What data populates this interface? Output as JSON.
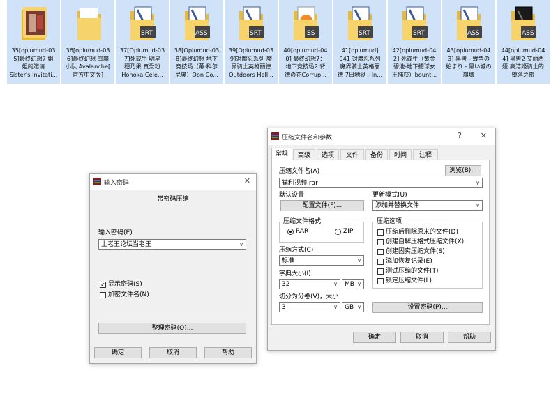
{
  "files": [
    {
      "name": "35[opiumud-03\n5]最终幻想7 姐\n姐的邀请\nSister's invitati...",
      "type": "video"
    },
    {
      "name": "36[opiumud-03\n6]最终幻想 雪崩\n小队 Avalanche[\n官方中文版]",
      "type": "folder"
    },
    {
      "name": "37[Opiumud-03\n7]死或生 明星\n穗乃果 真爱粉\nHonoka Cele...",
      "type": "srt"
    },
    {
      "name": "38[Opiumud-03\n8]最终幻想 地下\n竞技场（蒂·科尔\n尼奥）Don Co...",
      "type": "ass"
    },
    {
      "name": "39[Opiumud-03\n9]对魔忍系列 魔\n界骑士英格丽德\nOutdoors Hell...",
      "type": "srt"
    },
    {
      "name": "40[opiumud-04\n0] 最终幻想7：\n地下竞技场2 背\n德の花Corrup...",
      "type": "ss"
    },
    {
      "name": "41[opiumud]\n041 对魔忍系列\n魔界骑士英格丽\n德 7日地狱 - In...",
      "type": "srt"
    },
    {
      "name": "42[opiumud-04\n2] 死或生（黄金\n碧池-地下擂球女\n王捕获）bount...",
      "type": "srt"
    },
    {
      "name": "43[opiumud-04\n3] 黑兽 - 戦争の\n始まり - 黑い城の\n崩壊",
      "type": "ass"
    },
    {
      "name": "44[opiumud-04\n4] 黑兽2 艾丽西\n娅 高洁姬骑士的\n堕落之旅",
      "type": "dark"
    }
  ],
  "password_dialog": {
    "title": "输入密码",
    "header": "带密码压缩",
    "password_label": "输入密码(E)",
    "password_value": "上老王论坛当老王",
    "show_password": {
      "label": "显示密码(S)",
      "checked": true
    },
    "encrypt_names": {
      "label": "加密文件名(N)",
      "checked": false
    },
    "organize_button": "整理密码(O)...",
    "ok": "确定",
    "cancel": "取消",
    "help": "帮助",
    "close_glyph": "✕"
  },
  "archive_dialog": {
    "title": "压缩文件名和参数",
    "help_glyph": "?",
    "close_glyph": "✕",
    "tabs": [
      "常规",
      "高级",
      "选项",
      "文件",
      "备份",
      "时间",
      "注释"
    ],
    "archive_name_label": "压缩文件名(A)",
    "archive_name_value": "猫利视频.rar",
    "browse_button": "浏览(B)...",
    "default_settings_label": "默认设置",
    "profile_button": "配置文件(F)...",
    "update_mode_label": "更新模式(U)",
    "update_mode_value": "添加并替换文件",
    "format_group_label": "压缩文件格式",
    "format_rar": "RAR",
    "format_zip": "ZIP",
    "method_label": "压缩方式(C)",
    "method_value": "标准",
    "dict_label": "字典大小(I)",
    "dict_value": "32",
    "dict_unit": "MB",
    "split_label": "切分为分卷(V)，大小",
    "split_value": "3",
    "split_unit": "GB",
    "options_group_label": "压缩选项",
    "options": [
      {
        "label": "压缩后删除原来的文件(D)",
        "checked": false
      },
      {
        "label": "创建自解压格式压缩文件(X)",
        "checked": false
      },
      {
        "label": "创建固实压缩文件(S)",
        "checked": false
      },
      {
        "label": "添加恢复记录(E)",
        "checked": false
      },
      {
        "label": "测试压缩的文件(T)",
        "checked": false
      },
      {
        "label": "锁定压缩文件(L)",
        "checked": false
      }
    ],
    "set_password_button": "设置密码(P)...",
    "ok": "确定",
    "cancel": "取消",
    "help": "帮助"
  },
  "colors": {
    "selection_bg": "#cfe2f7",
    "folder": "#f7d36b",
    "folder_dark": "#e6b93f"
  }
}
